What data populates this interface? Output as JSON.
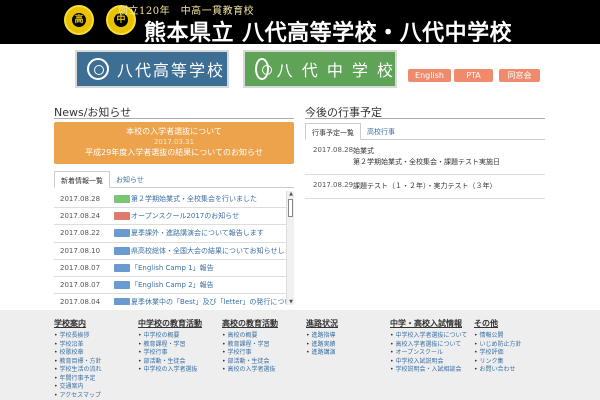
{
  "header": {
    "tagline": "創立120年　中高一貫教育校",
    "title": "熊本県立 八代高等学校・八代中学校",
    "emblem_left_char": "高",
    "emblem_right_char": "中"
  },
  "banners": {
    "high_school": "八代高等学校",
    "middle_school": "八 代 中 学 校"
  },
  "quick_links": {
    "english": "English",
    "pta": "PTA",
    "dosokai": "同窓会"
  },
  "news": {
    "title": "News/お知らせ",
    "featured": {
      "title": "本校の入学者選抜について",
      "date": "2017.03.31",
      "text": "平成29年度入学者選抜の結果についてのお知らせ"
    },
    "tabs": [
      "新着情報一覧",
      "お知らせ"
    ],
    "items": [
      {
        "date": "2017.08.28",
        "badge_color": "#7cc576",
        "text": "第２学期始業式・全校集会を行いました"
      },
      {
        "date": "2017.08.24",
        "badge_color": "#e07a6c",
        "text": "オープンスクール2017のお知らせ"
      },
      {
        "date": "2017.08.22",
        "badge_color": "#6a9bd0",
        "text": "夏季課外・進路講演会について報告します"
      },
      {
        "date": "2017.08.10",
        "badge_color": "#6a9bd0",
        "text": "県高校総体・全国大会の結果についてお知らせします"
      },
      {
        "date": "2017.08.07",
        "badge_color": "#6a9bd0",
        "text": "「English Camp 1」報告"
      },
      {
        "date": "2017.08.07",
        "badge_color": "#6a9bd0",
        "text": "「English Camp 2」報告"
      },
      {
        "date": "2017.08.04",
        "badge_color": "#6a9bd0",
        "text": "夏季休業中の「Best」及び「letter」の発行について（生徒会・図書委員会より）"
      }
    ]
  },
  "schedule": {
    "title": "今後の行事予定",
    "tabs": [
      "行事予定一覧",
      "高校行事"
    ],
    "items": [
      {
        "date": "2017.08.28",
        "line1": "始業式",
        "line2": "第２学期始業式・全校集会・課題テスト実施日"
      },
      {
        "date": "2017.08.29",
        "line1": "課題テスト（１・２年）・実力テスト（３年）",
        "line2": ""
      }
    ]
  },
  "footer": {
    "columns": [
      {
        "title": "学校案内",
        "items": [
          "学校長挨拶",
          "学校沿革",
          "校歌校章",
          "教育目標・方針",
          "学校生活の流れ",
          "年間行事予定",
          "交通案内",
          "アクセスマップ"
        ]
      },
      {
        "title": "中学校の教育活動",
        "items": [
          "中学校の概要",
          "教育課程・学習",
          "学校行事",
          "部活動・生徒会",
          "中学校の入学者選抜"
        ]
      },
      {
        "title": "高校の教育活動",
        "items": [
          "高校の概要",
          "教育課程・学習",
          "学校行事",
          "部活動・生徒会",
          "高校の入学者選抜"
        ]
      },
      {
        "title": "進路状況",
        "items": [
          "進路指導",
          "進路実績",
          "進路講演"
        ]
      },
      {
        "title": "中学・高校入試情報",
        "items": [
          "中学校入学者選抜について",
          "高校入学者選抜について",
          "オープンスクール",
          "中学校入試説明会",
          "学校説明会・入試相談会"
        ]
      },
      {
        "title": "その他",
        "items": [
          "情報公開",
          "いじめ防止方針",
          "学校評価",
          "リンク集",
          "お問い合わせ"
        ]
      }
    ]
  }
}
